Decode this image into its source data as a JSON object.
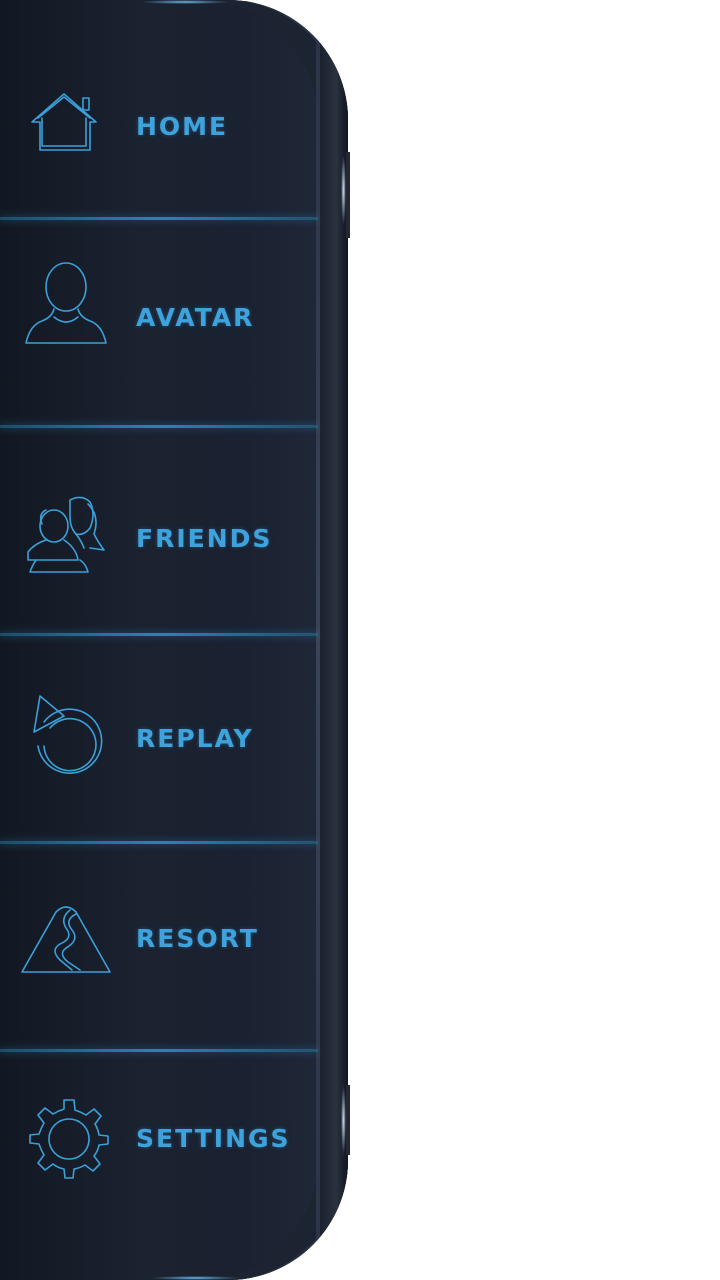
{
  "menu": {
    "items": [
      {
        "label": "HOME",
        "icon": "house-icon"
      },
      {
        "label": "AVATAR",
        "icon": "avatar-icon"
      },
      {
        "label": "FRIENDS",
        "icon": "friends-icon"
      },
      {
        "label": "REPLAY",
        "icon": "replay-icon"
      },
      {
        "label": "RESORT",
        "icon": "resort-mountain-icon"
      },
      {
        "label": "SETTINGS",
        "icon": "gear-icon"
      }
    ],
    "accent_color": "#3ea3dd",
    "panel_color": "#1b2230",
    "background_color": "#ffffff"
  }
}
